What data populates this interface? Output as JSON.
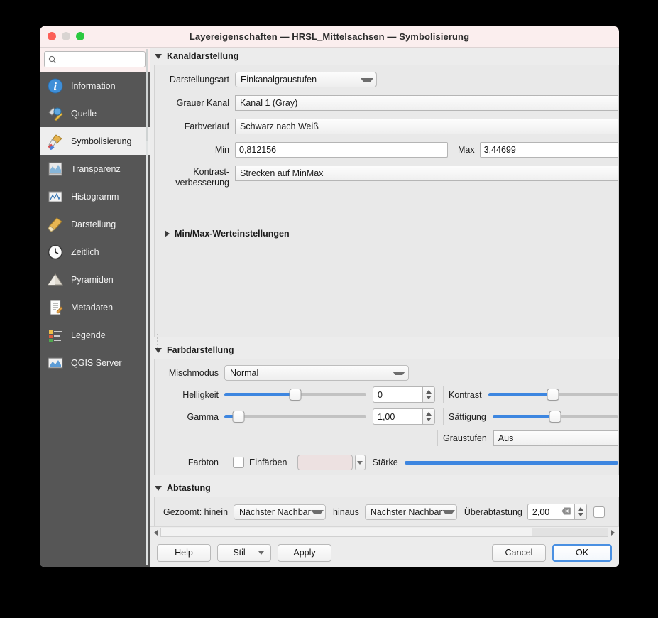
{
  "window": {
    "title": "Layereigenschaften  — HRSL_Mittelsachsen — Symbolisierung",
    "traffic": {
      "close": "close-button",
      "minimize": "minimize-button",
      "zoom": "zoom-button"
    }
  },
  "sidebar": {
    "search": {
      "placeholder": "",
      "value": "",
      "icon": "search-icon"
    },
    "items": [
      {
        "label": "Information",
        "icon": "information-icon",
        "active": false
      },
      {
        "label": "Quelle",
        "icon": "source-icon",
        "active": false
      },
      {
        "label": "Symbolisierung",
        "icon": "symbology-icon",
        "active": true
      },
      {
        "label": "Transparenz",
        "icon": "transparency-icon",
        "active": false
      },
      {
        "label": "Histogramm",
        "icon": "histogram-icon",
        "active": false
      },
      {
        "label": "Darstellung",
        "icon": "rendering-icon",
        "active": false
      },
      {
        "label": "Zeitlich",
        "icon": "temporal-icon",
        "active": false
      },
      {
        "label": "Pyramiden",
        "icon": "pyramids-icon",
        "active": false
      },
      {
        "label": "Metadaten",
        "icon": "metadata-icon",
        "active": false
      },
      {
        "label": "Legende",
        "icon": "legend-icon",
        "active": false
      },
      {
        "label": "QGIS Server",
        "icon": "qgis-server-icon",
        "active": false
      }
    ]
  },
  "band_rendering": {
    "title": "Kanaldarstellung",
    "expanded": true,
    "render_type": {
      "label": "Darstellungsart",
      "value": "Einkanalgraustufen"
    },
    "gray_band": {
      "label": "Grauer Kanal",
      "value": "Kanal 1 (Gray)"
    },
    "color_gradient": {
      "label": "Farbverlauf",
      "value": "Schwarz nach Weiß"
    },
    "min": {
      "label": "Min",
      "value": "0,812156"
    },
    "max": {
      "label": "Max",
      "value": "3,44699"
    },
    "contrast_enhancement": {
      "label": "Kontrast-\nverbesserung",
      "label_line1": "Kontrast-",
      "label_line2": "verbesserung",
      "value": "Strecken auf MinMax"
    },
    "minmax_settings": {
      "label": "Min/Max-Werteinstellungen",
      "expanded": false
    }
  },
  "color_rendering": {
    "title": "Farbdarstellung",
    "expanded": true,
    "blend_mode": {
      "label": "Mischmodus",
      "value": "Normal"
    },
    "brightness": {
      "label": "Helligkeit",
      "value": "0",
      "slider_percent": 50
    },
    "gamma": {
      "label": "Gamma",
      "value": "1,00",
      "slider_percent": 10
    },
    "contrast": {
      "label": "Kontrast",
      "slider_percent": 50
    },
    "saturation": {
      "label": "Sättigung",
      "slider_percent": 50
    },
    "grayscale": {
      "label": "Graustufen",
      "value": "Aus"
    },
    "hue": {
      "label": "Farbton"
    },
    "colorize": {
      "label": "Einfärben",
      "checked": false,
      "swatch_color": "#ede1e1"
    },
    "strength": {
      "label": "Stärke",
      "slider_percent": 100
    }
  },
  "resampling": {
    "title": "Abtastung",
    "expanded": true,
    "zoomed_label": "Gezoomt: hinein",
    "zoomed_in": {
      "value": "Nächster Nachbar"
    },
    "zoomed_out_label": "hinaus",
    "zoomed_out": {
      "value": "Nächster Nachbar"
    },
    "oversampling": {
      "label": "Überabtastung",
      "value": "2,00",
      "clear_icon": "clear-icon"
    }
  },
  "buttons": {
    "help": "Help",
    "style": "Stil",
    "apply": "Apply",
    "cancel": "Cancel",
    "ok": "OK"
  },
  "colors": {
    "accent": "#3d86e0",
    "titlebar": "#fbeeee",
    "sidebar": "#565656",
    "panel": "#ececec",
    "default_button_border": "#4a90e2"
  }
}
